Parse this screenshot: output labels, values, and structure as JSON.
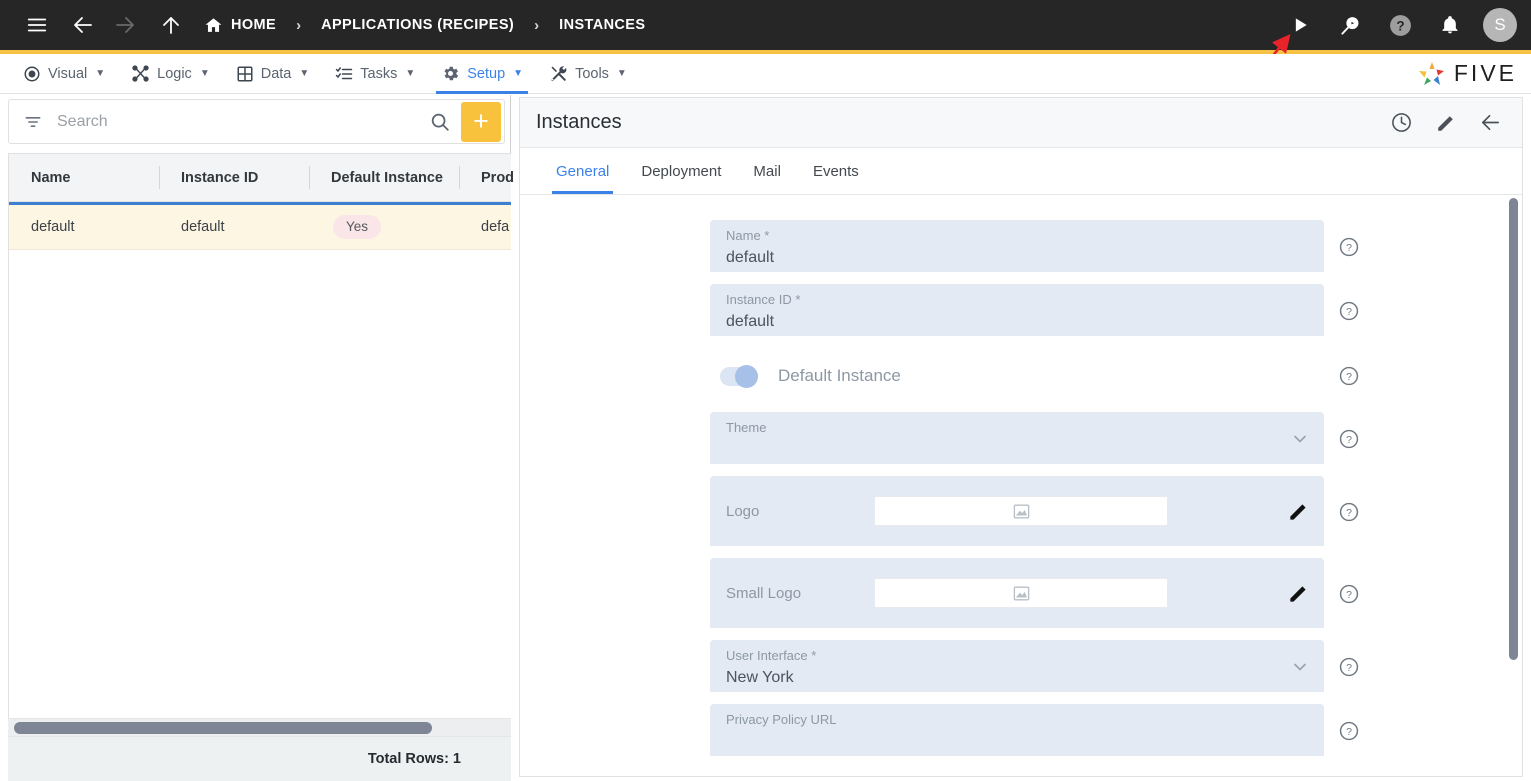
{
  "topbar": {
    "icons": {
      "menu": "hamburger-icon",
      "back": "back-arrow-icon",
      "forward": "forward-arrow-icon",
      "up": "up-arrow-icon"
    },
    "breadcrumbs": [
      {
        "label": "HOME",
        "icon": "home-icon"
      },
      {
        "label": "APPLICATIONS (RECIPES)",
        "icon": ""
      },
      {
        "label": "INSTANCES",
        "icon": ""
      }
    ],
    "separator": "›",
    "right_icons": [
      {
        "name": "run-play-icon"
      },
      {
        "name": "search-run-icon"
      },
      {
        "name": "help-circle-icon"
      },
      {
        "name": "notifications-bell-icon"
      }
    ],
    "avatar_initial": "S",
    "accent_color": "#f6c244",
    "background_color": "#262626"
  },
  "menubar": {
    "items": [
      {
        "label": "Visual",
        "icon": "eye-icon",
        "active": false
      },
      {
        "label": "Logic",
        "icon": "logic-nodes-icon",
        "active": false
      },
      {
        "label": "Data",
        "icon": "table-grid-icon",
        "active": false
      },
      {
        "label": "Tasks",
        "icon": "task-list-icon",
        "active": false
      },
      {
        "label": "Setup",
        "icon": "gear-icon",
        "active": true
      },
      {
        "label": "Tools",
        "icon": "tools-wrench-icon",
        "active": false
      }
    ],
    "caret": "▼",
    "active_color": "#3b82e8",
    "brand": "FIVE"
  },
  "left_panel": {
    "search": {
      "placeholder": "Search",
      "value": "",
      "filter_icon": "filter-icon",
      "search_icon": "search-icon",
      "add_label": "+"
    },
    "grid": {
      "columns": [
        "Name",
        "Instance ID",
        "Default Instance",
        "Prod"
      ],
      "rows": [
        {
          "name": "default",
          "instance_id": "default",
          "default_instance": "Yes",
          "prod": "defa"
        }
      ],
      "footer": "Total Rows: 1"
    }
  },
  "right_panel": {
    "title": "Instances",
    "actions": [
      {
        "name": "history-clock-icon"
      },
      {
        "name": "edit-pencil-icon"
      },
      {
        "name": "back-arrow-icon"
      }
    ],
    "tabs": [
      {
        "label": "General",
        "active": true
      },
      {
        "label": "Deployment",
        "active": false
      },
      {
        "label": "Mail",
        "active": false
      },
      {
        "label": "Events",
        "active": false
      }
    ],
    "fields": {
      "name": {
        "label": "Name *",
        "value": "default",
        "help": "?"
      },
      "instance_id": {
        "label": "Instance ID *",
        "value": "default",
        "help": "?"
      },
      "default_instance": {
        "label": "Default Instance",
        "checked": true,
        "help": "?"
      },
      "theme": {
        "label": "Theme",
        "value": "",
        "help": "?"
      },
      "logo": {
        "label": "Logo",
        "value": "",
        "help": "?",
        "edit_icon": "pencil-icon",
        "preview_icon": "image-placeholder-icon"
      },
      "small_logo": {
        "label": "Small Logo",
        "value": "",
        "help": "?",
        "edit_icon": "pencil-icon",
        "preview_icon": "image-placeholder-icon"
      },
      "user_interface": {
        "label": "User Interface *",
        "value": "New York",
        "help": "?"
      },
      "privacy_policy_url": {
        "label": "Privacy Policy URL",
        "value": "",
        "help": "?"
      }
    }
  },
  "annotation": {
    "type": "red-arrow",
    "color": "#e8232a",
    "points_to": "run-play-icon"
  }
}
